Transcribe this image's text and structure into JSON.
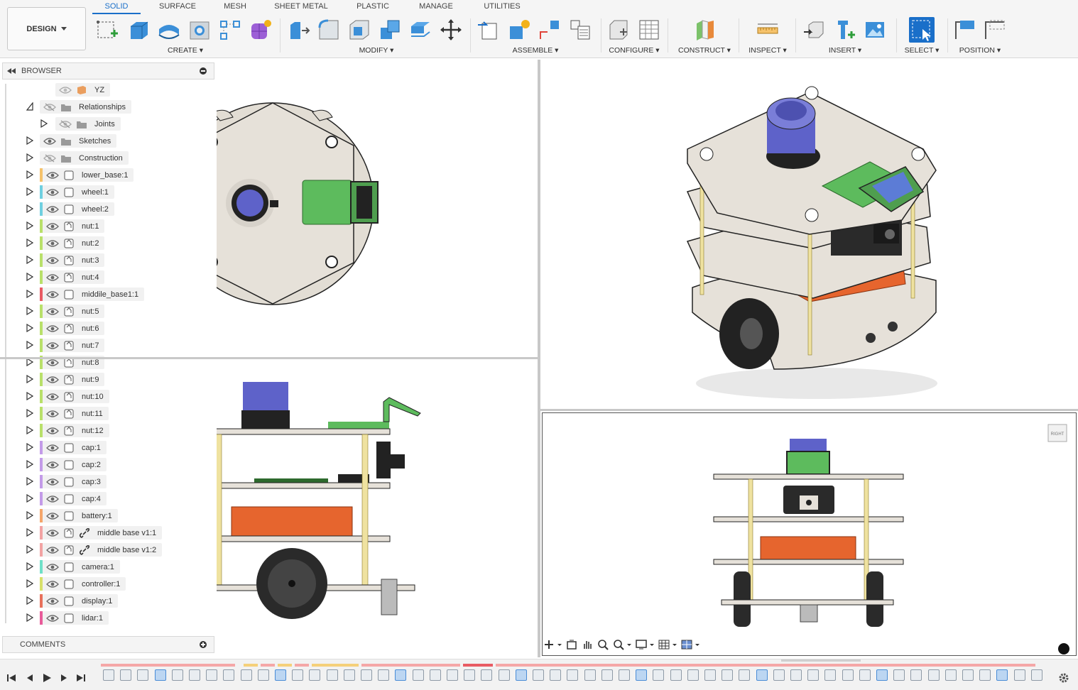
{
  "workspace": {
    "label": "DESIGN",
    "menu_icon": "caret-down-icon"
  },
  "tabs": [
    "SOLID",
    "SURFACE",
    "MESH",
    "SHEET METAL",
    "PLASTIC",
    "MANAGE",
    "UTILITIES"
  ],
  "active_tab": "SOLID",
  "groups": {
    "create": "CREATE",
    "modify": "MODIFY",
    "assemble": "ASSEMBLE",
    "configure": "CONFIGURE",
    "construct": "CONSTRUCT",
    "inspect": "INSPECT",
    "insert": "INSERT",
    "select": "SELECT",
    "position": "POSITION"
  },
  "browser": {
    "title": "BROWSER",
    "items": [
      {
        "label": "YZ",
        "color": ""
      },
      {
        "label": "Relationships",
        "color": ""
      },
      {
        "label": "Joints",
        "color": ""
      },
      {
        "label": "Sketches",
        "color": ""
      },
      {
        "label": "Construction",
        "color": ""
      },
      {
        "label": "lower_base:1",
        "color": "#f5c26b"
      },
      {
        "label": "wheel:1",
        "color": "#6fd0e0"
      },
      {
        "label": "wheel:2",
        "color": "#6fd0e0"
      },
      {
        "label": "nut:1",
        "color": "#b9e06a"
      },
      {
        "label": "nut:2",
        "color": "#b9e06a"
      },
      {
        "label": "nut:3",
        "color": "#b9e06a"
      },
      {
        "label": "nut:4",
        "color": "#b9e06a"
      },
      {
        "label": "middile_base1:1",
        "color": "#e85b63"
      },
      {
        "label": "nut:5",
        "color": "#b9e06a"
      },
      {
        "label": "nut:6",
        "color": "#b9e06a"
      },
      {
        "label": "nut:7",
        "color": "#b9e06a"
      },
      {
        "label": "nut:8",
        "color": "#b9e06a"
      },
      {
        "label": "nut:9",
        "color": "#b9e06a"
      },
      {
        "label": "nut:10",
        "color": "#b9e06a"
      },
      {
        "label": "nut:11",
        "color": "#b9e06a"
      },
      {
        "label": "nut:12",
        "color": "#b9e06a"
      },
      {
        "label": "cap:1",
        "color": "#c39be8"
      },
      {
        "label": "cap:2",
        "color": "#c39be8"
      },
      {
        "label": "cap:3",
        "color": "#c39be8"
      },
      {
        "label": "cap:4",
        "color": "#c39be8"
      },
      {
        "label": "battery:1",
        "color": "#f5a66b"
      },
      {
        "label": "middle base v1:1",
        "color": "#f2a3a3"
      },
      {
        "label": "middle base v1:2",
        "color": "#f2a3a3"
      },
      {
        "label": "camera:1",
        "color": "#6fe0c8"
      },
      {
        "label": "controller:1",
        "color": "#d7e06a"
      },
      {
        "label": "display:1",
        "color": "#e8705b"
      },
      {
        "label": "lidar:1",
        "color": "#e85b9a"
      }
    ]
  },
  "comments": {
    "title": "COMMENTS"
  },
  "viewcube": {
    "label": "RIGHT"
  },
  "colors": {
    "accent": "#1a6fc9",
    "plate": "#e6e1d9",
    "battery": "#e6652e",
    "lidar": "#5e62c9",
    "pcb": "#5dbb5d",
    "standoff": "#efe2a0"
  }
}
